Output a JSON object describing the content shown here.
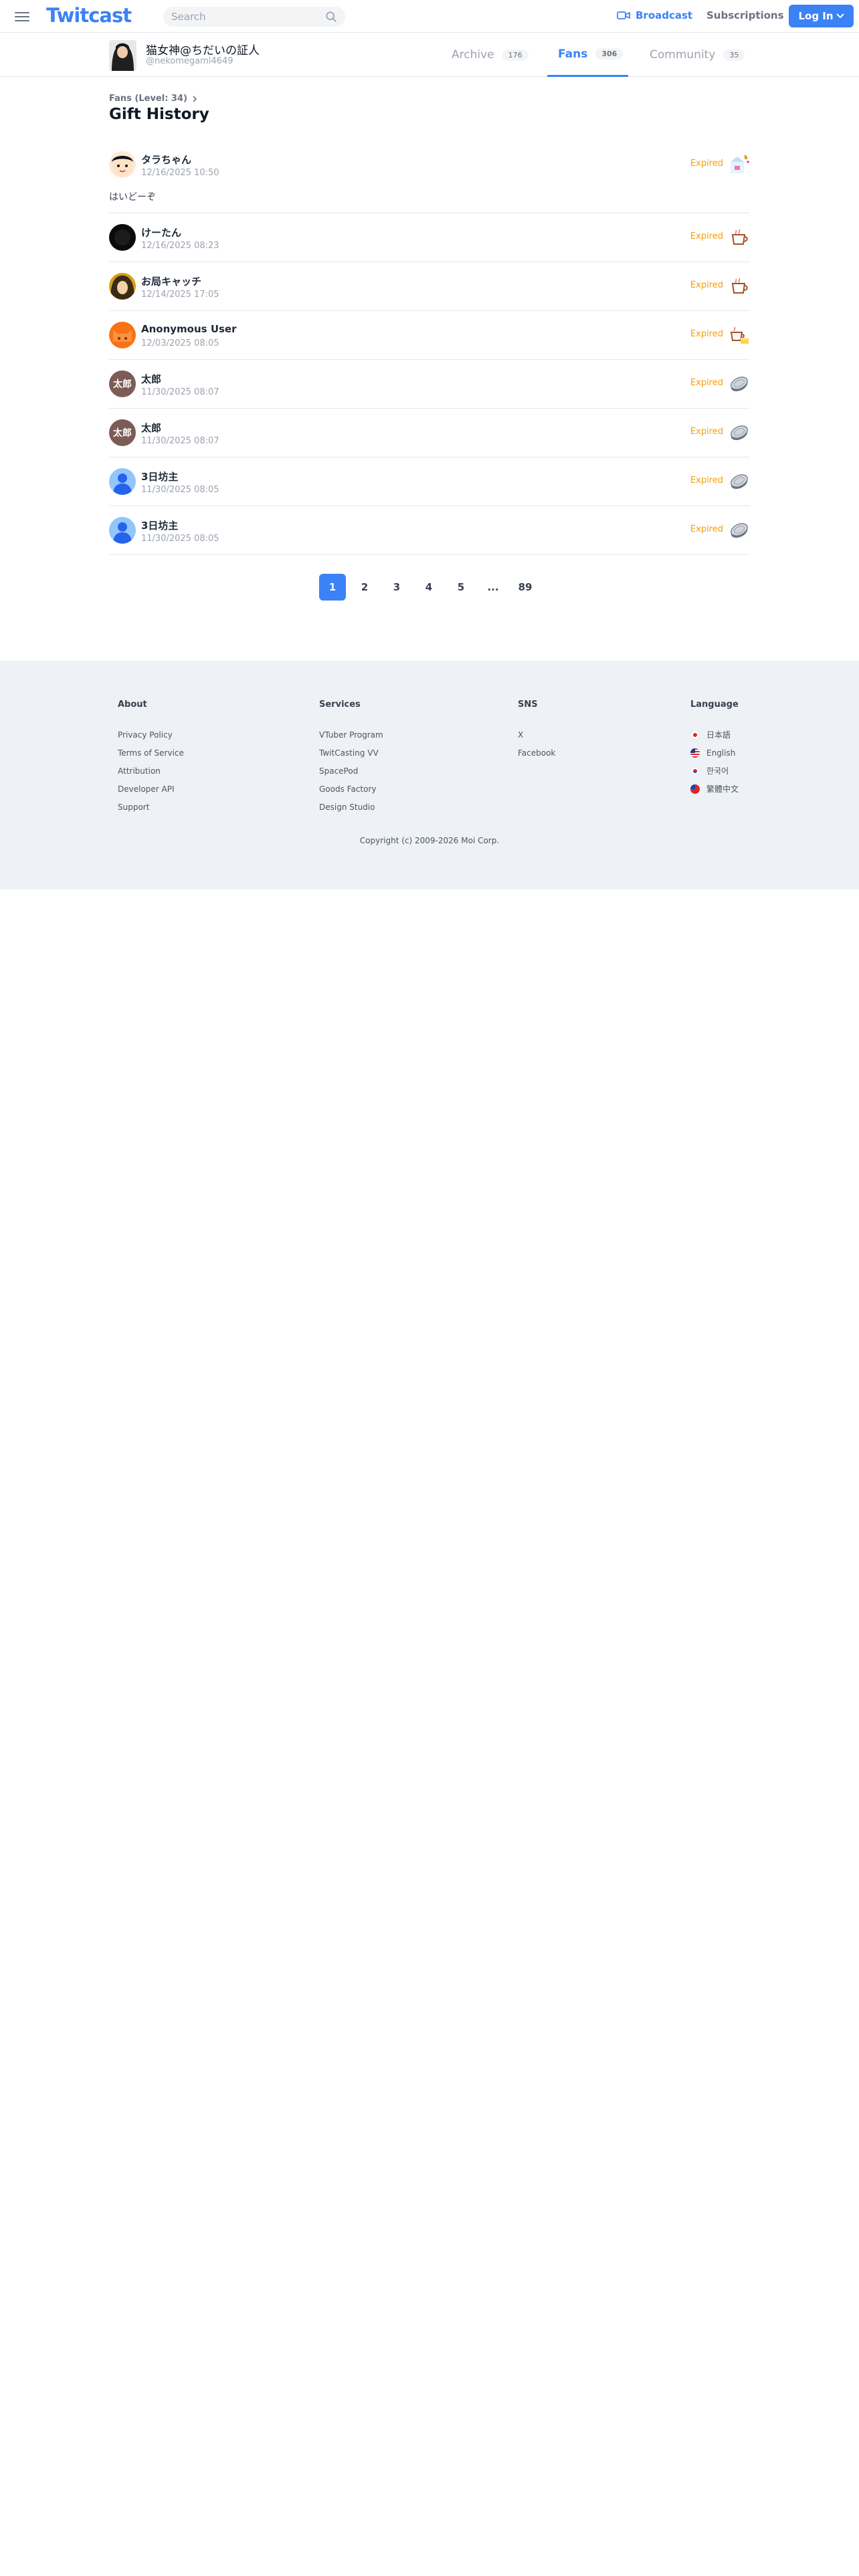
{
  "header": {
    "logo": "Twitcast",
    "search_placeholder": "Search",
    "broadcast_label": "Broadcast",
    "subscriptions_label": "Subscriptions",
    "login_label": "Log In",
    "brand_color": "#3b82f6"
  },
  "profile": {
    "name": "猫女神@ちだいの証人",
    "handle": "@nekomegami4649",
    "tabs": [
      {
        "label": "Archive",
        "count": "176",
        "active": false
      },
      {
        "label": "Fans",
        "count": "306",
        "active": true
      },
      {
        "label": "Community",
        "count": "35",
        "active": false
      }
    ]
  },
  "breadcrumb": "Fans (Level: 34)",
  "page_title": "Gift History",
  "gifts": [
    {
      "user": "タラちゃん",
      "date": "12/16/2025 10:50",
      "status": "Expired",
      "message": "はいどーぞ",
      "item_icon": "party-gift-icon"
    },
    {
      "user": "けーたん",
      "date": "12/16/2025 08:23",
      "status": "Expired",
      "item_icon": "tea-cup-icon"
    },
    {
      "user": "お局キャッチ",
      "date": "12/14/2025 17:05",
      "status": "Expired",
      "item_icon": "tea-cup-icon"
    },
    {
      "user": "Anonymous User",
      "date": "12/03/2025 08:05",
      "status": "Expired",
      "item_icon": "cup-and-cake-icon"
    },
    {
      "user": "太郎",
      "date": "11/30/2025 08:07",
      "status": "Expired",
      "item_icon": "coin-icon"
    },
    {
      "user": "太郎",
      "date": "11/30/2025 08:07",
      "status": "Expired",
      "item_icon": "coin-icon"
    },
    {
      "user": "3日坊主",
      "date": "11/30/2025 08:05",
      "status": "Expired",
      "item_icon": "coin-icon"
    },
    {
      "user": "3日坊主",
      "date": "11/30/2025 08:05",
      "status": "Expired",
      "item_icon": "coin-icon"
    }
  ],
  "taro_avatar_text": "太郎",
  "pagination": [
    "1",
    "2",
    "3",
    "4",
    "5",
    "...",
    "89"
  ],
  "footer": {
    "about": {
      "title": "About",
      "links": [
        "Privacy Policy",
        "Terms of Service",
        "Attribution",
        "Developer API",
        "Support"
      ]
    },
    "services": {
      "title": "Services",
      "links": [
        "VTuber Program",
        "TwitCasting VV",
        "SpacePod",
        "Goods Factory",
        "Design Studio"
      ]
    },
    "sns": {
      "title": "SNS",
      "links": [
        "X",
        "Facebook"
      ]
    },
    "language": {
      "title": "Language",
      "links": [
        "日本語",
        "English",
        "한국어",
        "繁體中文"
      ]
    },
    "copyright": "Copyright (c) 2009-2026 Moi Corp."
  }
}
